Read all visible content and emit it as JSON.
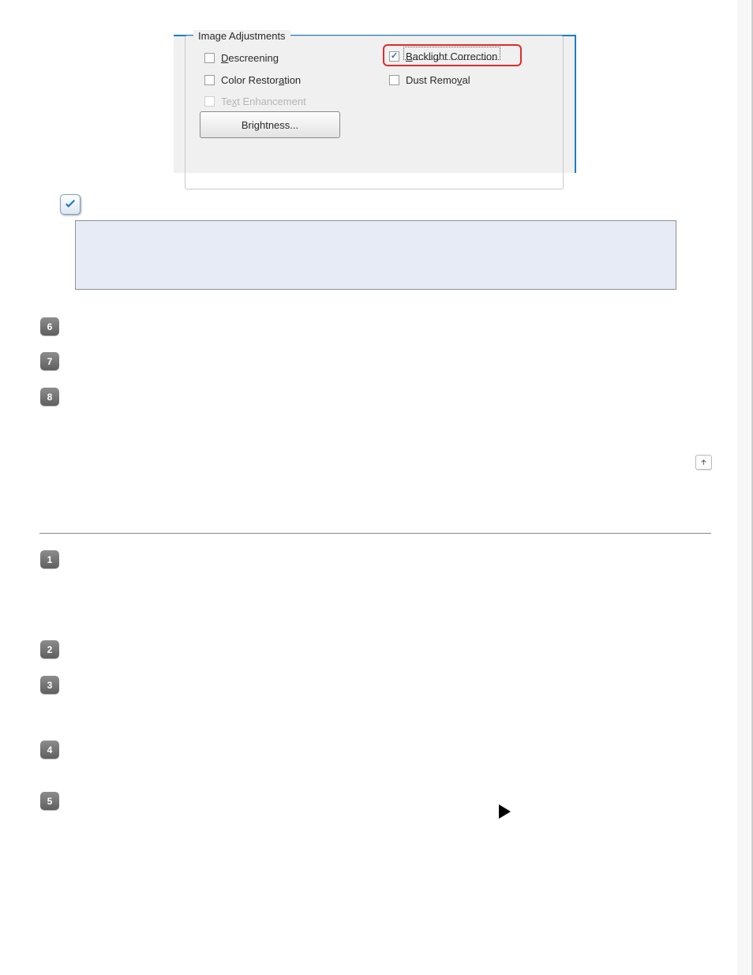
{
  "panel": {
    "group_title": "Image Adjustments",
    "options": {
      "descreening": {
        "label_html": "<u>D</u>escreening",
        "checked": false
      },
      "backlight": {
        "label_html": "<u>B</u>acklight Correction",
        "checked": true,
        "highlighted": true,
        "focused": true
      },
      "color_rest": {
        "label_html": "Color Restor<u>a</u>tion",
        "checked": false
      },
      "dust": {
        "label_html": "Dust Remo<u>v</u>al",
        "checked": false
      },
      "text_enh": {
        "label_html": "Te<u>x</u>t Enhancement",
        "checked": false,
        "disabled": true
      }
    },
    "brightness_button": "Brightness..."
  },
  "steps_first": [
    {
      "n": "6"
    },
    {
      "n": "7"
    },
    {
      "n": "8"
    }
  ],
  "steps_second": [
    {
      "n": "1"
    },
    {
      "n": "2"
    },
    {
      "n": "3"
    },
    {
      "n": "4"
    },
    {
      "n": "5"
    }
  ],
  "icons": {
    "note_icon": "note-icon",
    "top_icon": "to-top-icon",
    "play_icon": "play-icon"
  }
}
